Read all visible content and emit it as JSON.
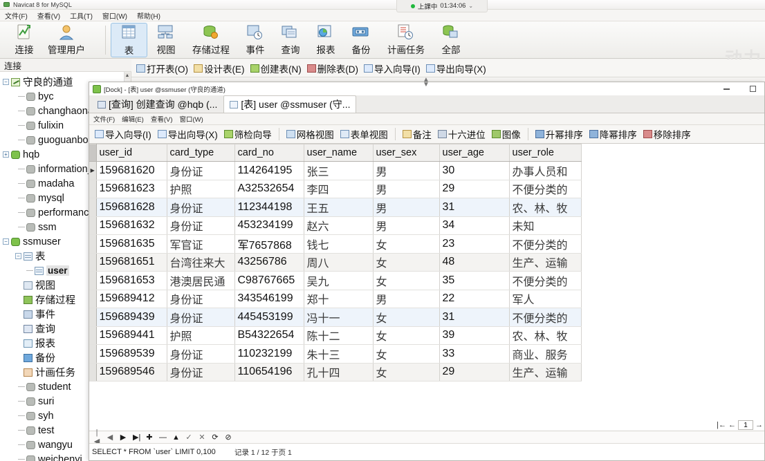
{
  "app": {
    "title": "Navicat 8 for MySQL",
    "title_icon": "navicat-icon"
  },
  "menubar": [
    {
      "label": "文件(F)",
      "key": "F"
    },
    {
      "label": "查看(V)",
      "key": "V"
    },
    {
      "label": "工具(T)",
      "key": "T"
    },
    {
      "label": "窗口(W)",
      "key": "W"
    },
    {
      "label": "帮助(H)",
      "key": "H"
    }
  ],
  "meeting": {
    "status": "上課中",
    "timer": "01:34:06",
    "caret": "⌄",
    "dot_color": "#20b83c"
  },
  "watermark": "动力",
  "bigbar": [
    {
      "label": "连接",
      "icon": "connection-icon",
      "selected": false
    },
    {
      "label": "管理用户",
      "icon": "manage-users-icon",
      "selected": false
    },
    {
      "label": "表",
      "icon": "table-icon",
      "selected": true
    },
    {
      "label": "视图",
      "icon": "view-icon",
      "selected": false
    },
    {
      "label": "存储过程",
      "icon": "procedure-icon",
      "selected": false
    },
    {
      "label": "事件",
      "icon": "event-icon",
      "selected": false
    },
    {
      "label": "查询",
      "icon": "query-icon",
      "selected": false
    },
    {
      "label": "报表",
      "icon": "report-icon",
      "selected": false
    },
    {
      "label": "备份",
      "icon": "backup-icon",
      "selected": false
    },
    {
      "label": "计画任务",
      "icon": "schedule-icon",
      "selected": false
    },
    {
      "label": "全部",
      "icon": "all-icon",
      "selected": false
    }
  ],
  "connection_pane": {
    "header": "连接",
    "root": "守良的通道",
    "items": [
      {
        "label": "byc",
        "type": "db-gray",
        "depth": 1,
        "expandable": false
      },
      {
        "label": "changhaona",
        "type": "db-gray",
        "depth": 1,
        "expandable": false
      },
      {
        "label": "fulixin",
        "type": "db-gray",
        "depth": 1,
        "expandable": false
      },
      {
        "label": "guoguanbo",
        "type": "db-gray",
        "depth": 1,
        "expandable": false
      },
      {
        "label": "hqb",
        "type": "db-green",
        "depth": 1,
        "expandable": true
      },
      {
        "label": "information_",
        "type": "db-gray",
        "depth": 1,
        "expandable": false
      },
      {
        "label": "madaha",
        "type": "db-gray",
        "depth": 1,
        "expandable": false
      },
      {
        "label": "mysql",
        "type": "db-gray",
        "depth": 1,
        "expandable": false
      },
      {
        "label": "performance",
        "type": "db-gray",
        "depth": 1,
        "expandable": false
      },
      {
        "label": "ssm",
        "type": "db-gray",
        "depth": 1,
        "expandable": false
      },
      {
        "label": "ssmuser",
        "type": "db-green",
        "depth": 1,
        "expandable": true,
        "expanded": true
      },
      {
        "label": "表",
        "type": "folder-table",
        "depth": 2,
        "expandable": true,
        "expanded": true
      },
      {
        "label": "user",
        "type": "table",
        "depth": 3,
        "selected": true
      },
      {
        "label": "视图",
        "type": "folder-view",
        "depth": 2
      },
      {
        "label": "存储过程",
        "type": "folder-proc",
        "depth": 2
      },
      {
        "label": "事件",
        "type": "folder-event",
        "depth": 2
      },
      {
        "label": "查询",
        "type": "folder-query",
        "depth": 2
      },
      {
        "label": "报表",
        "type": "folder-report",
        "depth": 2
      },
      {
        "label": "备份",
        "type": "folder-backup",
        "depth": 2
      },
      {
        "label": "计画任务",
        "type": "folder-task",
        "depth": 2
      },
      {
        "label": "student",
        "type": "db-gray",
        "depth": 1
      },
      {
        "label": "suri",
        "type": "db-gray",
        "depth": 1
      },
      {
        "label": "syh",
        "type": "db-gray",
        "depth": 1
      },
      {
        "label": "test",
        "type": "db-gray",
        "depth": 1
      },
      {
        "label": "wangyu",
        "type": "db-gray",
        "depth": 1
      },
      {
        "label": "weichenyi",
        "type": "db-gray",
        "depth": 1
      }
    ]
  },
  "object_toolbar": [
    {
      "label": "打开表(O)",
      "icon": "open-table-icon"
    },
    {
      "label": "设计表(E)",
      "icon": "design-table-icon"
    },
    {
      "label": "创建表(N)",
      "icon": "create-table-icon"
    },
    {
      "label": "删除表(D)",
      "icon": "delete-table-icon"
    },
    {
      "label": "导入向导(I)",
      "icon": "import-wizard-icon"
    },
    {
      "label": "导出向导(X)",
      "icon": "export-wizard-icon"
    }
  ],
  "child_window": {
    "title": "[Dock] - [表] user @ssmuser (守良的通道)",
    "title_icon": "navicat-icon",
    "buttons": {
      "minimize": "minimize-icon",
      "maximize": "maximize-icon"
    },
    "tabs": [
      {
        "label": "[查询] 创建查询 @hqb (...",
        "icon": "query-icon",
        "active": false
      },
      {
        "label": "[表] user @ssmuser (守...",
        "icon": "table-icon",
        "active": true
      }
    ],
    "menubar": [
      {
        "label": "文件(F)"
      },
      {
        "label": "编辑(E)"
      },
      {
        "label": "查看(V)"
      },
      {
        "label": "窗口(W)"
      }
    ],
    "toolbar_groups": [
      [
        {
          "label": "导入向导(I)",
          "icon": "import-wizard-icon"
        },
        {
          "label": "导出向导(X)",
          "icon": "export-wizard-icon"
        },
        {
          "label": "筛检向导",
          "icon": "filter-wizard-icon"
        }
      ],
      [
        {
          "label": "网格视图",
          "icon": "grid-view-icon"
        },
        {
          "label": "表单视图",
          "icon": "form-view-icon"
        }
      ],
      [
        {
          "label": "备注",
          "icon": "memo-icon"
        },
        {
          "label": "十六进位",
          "icon": "hex-icon"
        },
        {
          "label": "图像",
          "icon": "image-icon"
        }
      ],
      [
        {
          "label": "升幂排序",
          "icon": "sort-asc-icon"
        },
        {
          "label": "降幂排序",
          "icon": "sort-desc-icon"
        },
        {
          "label": "移除排序",
          "icon": "sort-remove-icon"
        }
      ]
    ],
    "nav_buttons": [
      {
        "icon": "first-record-icon",
        "enabled": false
      },
      {
        "icon": "prev-record-icon",
        "enabled": false
      },
      {
        "icon": "next-record-icon",
        "enabled": true
      },
      {
        "icon": "last-record-icon",
        "enabled": true
      },
      {
        "icon": "add-record-icon",
        "enabled": true
      },
      {
        "icon": "delete-record-icon",
        "enabled": true
      },
      {
        "icon": "apply-change-icon",
        "enabled": true
      },
      {
        "icon": "edit-record-icon",
        "enabled": false
      },
      {
        "icon": "cancel-change-icon",
        "enabled": false
      },
      {
        "icon": "refresh-icon",
        "enabled": true
      },
      {
        "icon": "stop-icon",
        "enabled": true
      }
    ],
    "sql_status": "SELECT * FROM `user` LIMIT 0,100",
    "record_info": "记录 1 / 12 于页 1",
    "pager": {
      "first": "first-page-icon",
      "prev": "prev-page-icon",
      "page_value": "1",
      "next": "next-page-icon"
    }
  },
  "table": {
    "columns": [
      "user_id",
      "card_type",
      "card_no",
      "user_name",
      "user_sex",
      "user_age",
      "user_role"
    ],
    "rows": [
      {
        "user_id": "159681620",
        "card_type": "身份证",
        "card_no": "114264195",
        "user_name": "张三",
        "user_sex": "男",
        "user_age": "30",
        "user_role": "办事人员和",
        "current": true
      },
      {
        "user_id": "159681623",
        "card_type": "护照",
        "card_no": "A32532654",
        "user_name": "李四",
        "user_sex": "男",
        "user_age": "29",
        "user_role": "不便分类的"
      },
      {
        "user_id": "159681628",
        "card_type": "身份证",
        "card_no": "112344198",
        "user_name": "王五",
        "user_sex": "男",
        "user_age": "31",
        "user_role": "农、林、牧",
        "highlight": true
      },
      {
        "user_id": "159681632",
        "card_type": "身份证",
        "card_no": "453234199",
        "user_name": "赵六",
        "user_sex": "男",
        "user_age": "34",
        "user_role": "未知"
      },
      {
        "user_id": "159681635",
        "card_type": "军官证",
        "card_no": "军7657868",
        "user_name": "钱七",
        "user_sex": "女",
        "user_age": "23",
        "user_role": "不便分类的"
      },
      {
        "user_id": "159681651",
        "card_type": "台湾往来大",
        "card_no": "43256786",
        "user_name": "周八",
        "user_sex": "女",
        "user_age": "48",
        "user_role": "生产、运输",
        "alt": true
      },
      {
        "user_id": "159681653",
        "card_type": "港澳居民通",
        "card_no": "C98767665",
        "user_name": "吴九",
        "user_sex": "女",
        "user_age": "35",
        "user_role": "不便分类的"
      },
      {
        "user_id": "159689412",
        "card_type": "身份证",
        "card_no": "343546199",
        "user_name": "郑十",
        "user_sex": "男",
        "user_age": "22",
        "user_role": "军人"
      },
      {
        "user_id": "159689439",
        "card_type": "身份证",
        "card_no": "445453199",
        "user_name": "冯十一",
        "user_sex": "女",
        "user_age": "31",
        "user_role": "不便分类的",
        "highlight": true
      },
      {
        "user_id": "159689441",
        "card_type": "护照",
        "card_no": "B54322654",
        "user_name": "陈十二",
        "user_sex": "女",
        "user_age": "39",
        "user_role": "农、林、牧"
      },
      {
        "user_id": "159689539",
        "card_type": "身份证",
        "card_no": "110232199",
        "user_name": "朱十三",
        "user_sex": "女",
        "user_age": "33",
        "user_role": "商业、服务"
      },
      {
        "user_id": "159689546",
        "card_type": "身份证",
        "card_no": "110654196",
        "user_name": "孔十四",
        "user_sex": "女",
        "user_age": "29",
        "user_role": "生产、运输",
        "alt": true
      }
    ]
  }
}
